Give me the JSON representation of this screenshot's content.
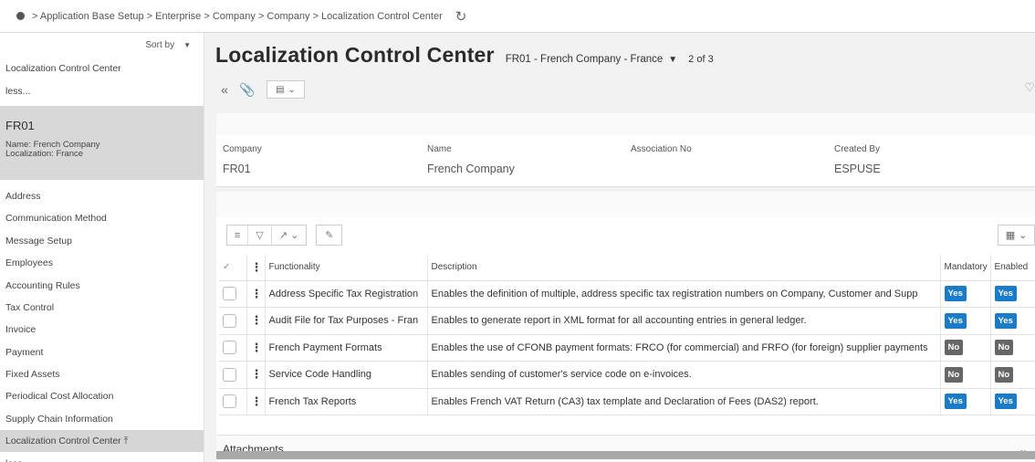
{
  "breadcrumb": {
    "text": "> Application Base Setup > Enterprise > Company > Company > Localization Control Center"
  },
  "sidebar": {
    "sort_label": "Sort by",
    "top_items": [
      {
        "label": "Localization Control Center"
      },
      {
        "label": "less..."
      }
    ],
    "selected": {
      "code": "FR01",
      "name_line": "Name:  French Company",
      "localization_line": "Localization:  France"
    },
    "items": [
      {
        "label": "Address"
      },
      {
        "label": "Communication Method"
      },
      {
        "label": "Message Setup"
      },
      {
        "label": "Employees"
      },
      {
        "label": "Accounting Rules"
      },
      {
        "label": "Tax Control"
      },
      {
        "label": "Invoice"
      },
      {
        "label": "Payment"
      },
      {
        "label": "Fixed Assets"
      },
      {
        "label": "Periodical Cost Allocation"
      },
      {
        "label": "Supply Chain Information"
      }
    ],
    "active_item": "Localization Control Center ⤒",
    "bottom_less": "less..."
  },
  "header": {
    "title": "Localization Control Center",
    "record": "FR01 - French Company - France",
    "count": "2 of 3"
  },
  "company_card": {
    "fields": [
      {
        "label": "Company",
        "value": "FR01"
      },
      {
        "label": "Name",
        "value": "French Company"
      },
      {
        "label": "Association No",
        "value": ""
      },
      {
        "label": "Created By",
        "value": "ESPUSE"
      }
    ]
  },
  "table": {
    "columns": [
      "Functionality",
      "Description",
      "Mandatory",
      "Enabled"
    ],
    "rows": [
      {
        "functionality": "Address Specific Tax Registration",
        "description": "Enables the definition of multiple, address specific tax registration numbers on Company, Customer and Supp",
        "mandatory": "Yes",
        "enabled": "Yes"
      },
      {
        "functionality": "Audit File for Tax Purposes - Fran",
        "description": "Enables to generate report in XML format for all accounting entries in general ledger.",
        "mandatory": "Yes",
        "enabled": "Yes"
      },
      {
        "functionality": "French Payment Formats",
        "description": "Enables the use of CFONB payment formats: FRCO (for commercial) and FRFO (for foreign) supplier payments",
        "mandatory": "No",
        "enabled": "No"
      },
      {
        "functionality": "Service Code Handling",
        "description": "Enables sending of customer's service code on e-invoices.",
        "mandatory": "No",
        "enabled": "No"
      },
      {
        "functionality": "French Tax Reports",
        "description": "Enables French VAT Return (CA3) tax template and Declaration of Fees (DAS2) report.",
        "mandatory": "Yes",
        "enabled": "Yes"
      }
    ]
  },
  "attachments": {
    "label": "Attachments"
  },
  "colors": {
    "yes_badge": "#1a7bc8",
    "no_badge": "#666666",
    "selected_bg": "#d8d8d8",
    "main_bg": "#f2f2f2"
  }
}
